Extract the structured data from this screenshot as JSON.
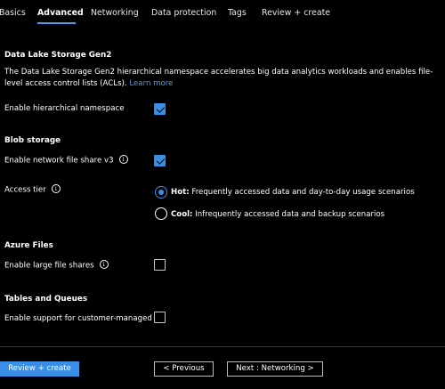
{
  "tabs": {
    "basics": "Basics",
    "advanced": "Advanced",
    "networking": "Networking",
    "data_protection": "Data protection",
    "tags": "Tags",
    "review": "Review + create"
  },
  "dls": {
    "title": "Data Lake Storage Gen2",
    "description": "The Data Lake Storage Gen2 hierarchical namespace accelerates big data analytics workloads and enables file-level access control lists (ACLs).",
    "learn_more": "Learn more",
    "hns_label": "Enable hierarchical namespace",
    "hns_checked": true
  },
  "blob": {
    "title": "Blob storage",
    "nfs_label": "Enable network file share v3",
    "nfs_checked": true,
    "access_tier_label": "Access tier",
    "hot_label": "Hot:",
    "hot_desc": "Frequently accessed data and day-to-day usage scenarios",
    "cool_label": "Cool:",
    "cool_desc": "Infrequently accessed data and backup scenarios",
    "selected_tier": "Hot"
  },
  "files": {
    "title": "Azure Files",
    "large_shares_label": "Enable large file shares",
    "large_shares_checked": false
  },
  "tables": {
    "title": "Tables and Queues",
    "cmk_label": "Enable support for customer-managed",
    "cmk_checked": false
  },
  "footer": {
    "review_create": "Review + create",
    "previous": "< Previous",
    "next": "Next : Networking >"
  },
  "icons": {
    "info": "info-icon",
    "check": "checkmark-icon"
  },
  "colors": {
    "accent": "#3a8ee6",
    "link": "#4f9ce8",
    "background": "#000000",
    "text": "#ffffff"
  }
}
